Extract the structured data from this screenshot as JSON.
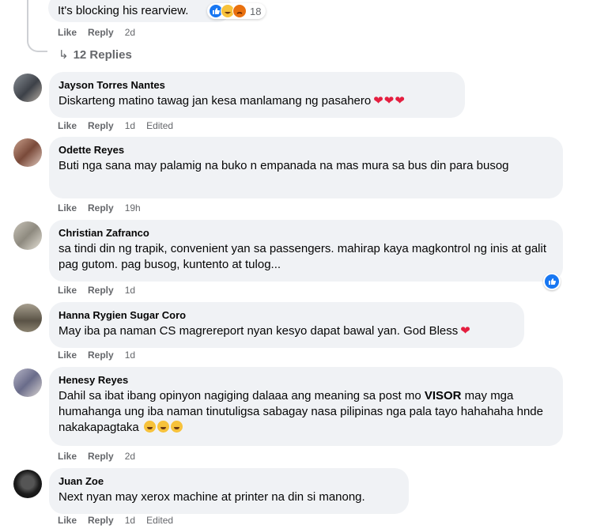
{
  "top_comment": {
    "text": "It's blocking his rearview.",
    "reaction_count": "18",
    "actions": {
      "like": "Like",
      "reply": "Reply",
      "time": "2d"
    },
    "replies_label": "12 Replies"
  },
  "comments": [
    {
      "author": "Jayson Torres Nantes",
      "text": "Diskarteng matino tawag jan kesa manlamang ng pasahero",
      "emoji_suffix": "❤❤❤",
      "like": "Like",
      "reply": "Reply",
      "time": "1d",
      "edited": "Edited"
    },
    {
      "author": "Odette Reyes",
      "text": "Buti nga sana may palamig na buko n empanada na mas mura sa bus din para busog",
      "like": "Like",
      "reply": "Reply",
      "time": "19h"
    },
    {
      "author": "Christian Zafranco",
      "text": "sa tindi din ng trapik, convenient yan sa passengers. mahirap kaya magkontrol ng inis at galit pag gutom. pag busog, kuntento at tulog...",
      "like": "Like",
      "reply": "Reply",
      "time": "1d"
    },
    {
      "author": "Hanna Rygien Sugar Coro",
      "text": "May iba pa naman CS magrereport nyan kesyo dapat bawal yan. God Bless",
      "emoji_suffix": "❤",
      "like": "Like",
      "reply": "Reply",
      "time": "1d"
    },
    {
      "author": "Henesy Reyes",
      "text_before": "Dahil sa ibat ibang opinyon nagiging dalaaa ang meaning sa post mo ",
      "text_bold": "VISOR",
      "text_after": " may mga humahanga ung iba naman tinutuligsa sabagay nasa pilipinas nga pala tayo hahahaha hnde nakakapagtaka",
      "like": "Like",
      "reply": "Reply",
      "time": "2d"
    },
    {
      "author": "Juan Zoe",
      "text": "Next nyan may xerox machine at printer na din si manong.",
      "like": "Like",
      "reply": "Reply",
      "time": "1d",
      "edited": "Edited"
    }
  ],
  "colors": {
    "bubble": "#f0f2f5",
    "meta": "#65676b",
    "heart": "#e41e3f",
    "like_blue": "#1877f2"
  },
  "icons": {
    "reply_arrow": "reply-arrow-icon",
    "like_reaction": "like-reaction-icon",
    "haha_reaction": "haha-reaction-icon",
    "angry_reaction": "angry-reaction-icon"
  }
}
